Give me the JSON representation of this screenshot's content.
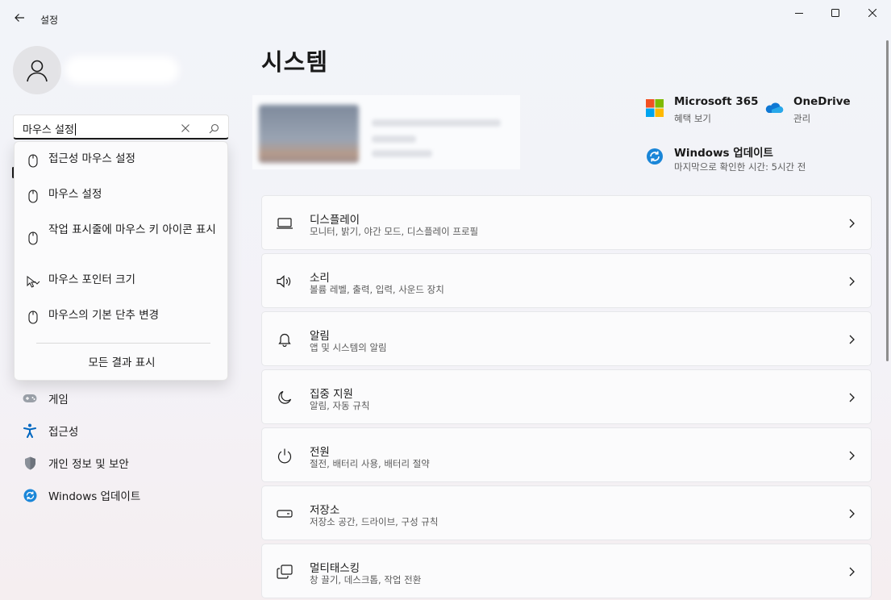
{
  "window": {
    "title": "설정",
    "controls": [
      "minimize",
      "maximize",
      "close"
    ]
  },
  "search": {
    "value": "마우스 설정",
    "suggestions": [
      {
        "label": "접근성 마우스 설정",
        "icon": "mouse-icon"
      },
      {
        "label": "마우스 설정",
        "icon": "mouse-icon"
      },
      {
        "label": "작업 표시줄에 마우스 키 아이콘 표시",
        "icon": "mouse-icon"
      },
      {
        "label": "마우스 포인터 크기",
        "icon": "pointer-icon"
      },
      {
        "label": "마우스의 기본 단추 변경",
        "icon": "mouse-icon"
      }
    ],
    "show_all": "모든 결과 표시"
  },
  "sidebar": {
    "items": [
      {
        "label": "게임",
        "icon": "gamepad-icon"
      },
      {
        "label": "접근성",
        "icon": "accessibility-icon"
      },
      {
        "label": "개인 정보 및 보안",
        "icon": "shield-icon"
      },
      {
        "label": "Windows 업데이트",
        "icon": "update-icon"
      }
    ]
  },
  "main": {
    "title": "시스템",
    "services": [
      {
        "title": "Microsoft 365",
        "subtitle": "혜택 보기",
        "icon": "microsoft-logo-icon"
      },
      {
        "title": "OneDrive",
        "subtitle": "관리",
        "icon": "onedrive-icon"
      },
      {
        "title": "Windows 업데이트",
        "subtitle": "마지막으로 확인한 시간: 5시간 전",
        "icon": "windows-update-icon"
      }
    ],
    "settings": [
      {
        "title": "디스플레이",
        "subtitle": "모니터, 밝기, 야간 모드, 디스플레이 프로필",
        "icon": "display-icon"
      },
      {
        "title": "소리",
        "subtitle": "볼륨 레벨, 출력, 입력, 사운드 장치",
        "icon": "speaker-icon"
      },
      {
        "title": "알림",
        "subtitle": "앱 및 시스템의 알림",
        "icon": "bell-icon"
      },
      {
        "title": "집중 지원",
        "subtitle": "알림, 자동 규칙",
        "icon": "moon-icon"
      },
      {
        "title": "전원",
        "subtitle": "절전, 배터리 사용, 배터리 절약",
        "icon": "power-icon"
      },
      {
        "title": "저장소",
        "subtitle": "저장소 공간, 드라이브, 구성 규칙",
        "icon": "storage-icon"
      },
      {
        "title": "멀티태스킹",
        "subtitle": "창 끌기, 데스크톱, 작업 전환",
        "icon": "multitasking-icon"
      }
    ]
  },
  "colors": {
    "accent": "#0067c0",
    "ms_red": "#f25022",
    "ms_green": "#7fba00",
    "ms_blue": "#00a4ef",
    "ms_yellow": "#ffb900"
  }
}
